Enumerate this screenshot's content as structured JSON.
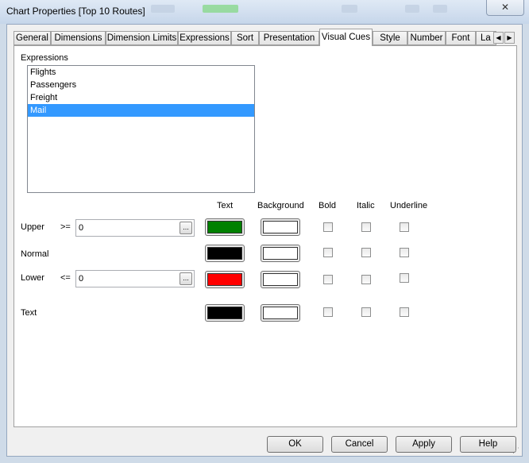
{
  "window": {
    "title": "Chart Properties [Top 10 Routes]",
    "close_glyph": "✕"
  },
  "tabs": [
    {
      "label": "General"
    },
    {
      "label": "Dimensions"
    },
    {
      "label": "Dimension Limits"
    },
    {
      "label": "Expressions"
    },
    {
      "label": "Sort"
    },
    {
      "label": "Presentation"
    },
    {
      "label": "Visual Cues",
      "active": true
    },
    {
      "label": "Style"
    },
    {
      "label": "Number"
    },
    {
      "label": "Font"
    },
    {
      "label": "La"
    }
  ],
  "tab_scroll": {
    "left": "◀",
    "right": "▶"
  },
  "expressions": {
    "label": "Expressions",
    "items": [
      "Flights",
      "Passengers",
      "Freight",
      "Mail"
    ],
    "selected": "Mail"
  },
  "columns": {
    "text": "Text",
    "background": "Background",
    "bold": "Bold",
    "italic": "Italic",
    "underline": "Underline"
  },
  "rows": {
    "upper": {
      "label": "Upper",
      "operator": ">=",
      "value": "0",
      "text_color": "#008000",
      "bg_color": "#ffffff"
    },
    "normal": {
      "label": "Normal",
      "text_color": "#000000",
      "bg_color": "#ffffff"
    },
    "lower": {
      "label": "Lower",
      "operator": "<=",
      "value": "0",
      "text_color": "#ff0000",
      "bg_color": "#ffffff"
    },
    "text": {
      "label": "Text",
      "text_color": "#000000",
      "bg_color": "#ffffff"
    }
  },
  "ellipsis": "...",
  "buttons": {
    "ok": "OK",
    "cancel": "Cancel",
    "apply": "Apply",
    "help": "Help"
  }
}
